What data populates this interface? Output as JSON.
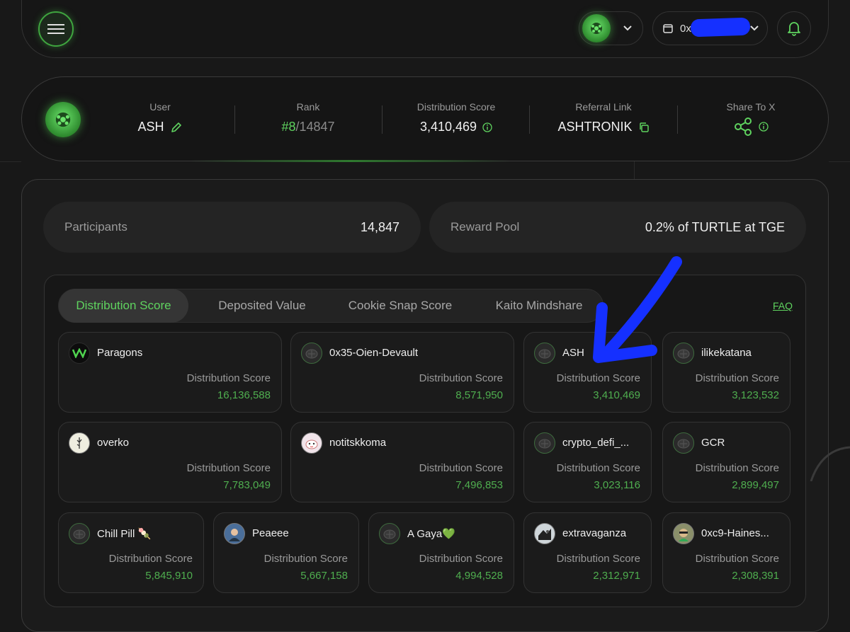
{
  "topbar": {
    "wallet_prefix": "0x"
  },
  "user_stats": {
    "user_label": "User",
    "user_value": "ASH",
    "rank_label": "Rank",
    "rank_value": "#8",
    "rank_total": "/14847",
    "score_label": "Distribution Score",
    "score_value": "3,410,469",
    "referral_label": "Referral Link",
    "referral_value": "ASHTRONIK",
    "share_label": "Share To X"
  },
  "summary": {
    "participants_label": "Participants",
    "participants_value": "14,847",
    "reward_label": "Reward Pool",
    "reward_value": "0.2% of TURTLE at TGE"
  },
  "tabs": [
    {
      "label": "Distribution Score",
      "active": true
    },
    {
      "label": "Deposited Value",
      "active": false
    },
    {
      "label": "Cookie Snap Score",
      "active": false
    },
    {
      "label": "Kaito Mindshare",
      "active": false
    }
  ],
  "faq_label": "FAQ",
  "leaderboard": [
    {
      "name": "Paragons",
      "score_label": "Distribution Score",
      "score": "16,136,588"
    },
    {
      "name": "0x35-Oien-Devault",
      "score_label": "Distribution Score",
      "score": "8,571,950"
    },
    {
      "name": "ASH",
      "score_label": "Distribution Score",
      "score": "3,410,469"
    },
    {
      "name": "ilikekatana",
      "score_label": "Distribution Score",
      "score": "3,123,532"
    },
    {
      "name": "overko",
      "score_label": "Distribution Score",
      "score": "7,783,049"
    },
    {
      "name": "notitskkoma",
      "score_label": "Distribution Score",
      "score": "7,496,853"
    },
    {
      "name": "crypto_defi_...",
      "score_label": "Distribution Score",
      "score": "3,023,116"
    },
    {
      "name": "GCR",
      "score_label": "Distribution Score",
      "score": "2,899,497"
    },
    {
      "name": "Chill Pill 🍡",
      "score_label": "Distribution Score",
      "score": "5,845,910"
    },
    {
      "name": "Peaeee",
      "score_label": "Distribution Score",
      "score": "5,667,158"
    },
    {
      "name": "A Gaya💚",
      "score_label": "Distribution Score",
      "score": "4,994,528"
    },
    {
      "name": "extravaganza",
      "score_label": "Distribution Score",
      "score": "2,312,971"
    },
    {
      "name": "0xc9-Haines...",
      "score_label": "Distribution Score",
      "score": "2,308,391"
    }
  ],
  "colors": {
    "accent": "#5fd35f",
    "background": "#181818",
    "annotation_arrow": "#1530ff"
  }
}
